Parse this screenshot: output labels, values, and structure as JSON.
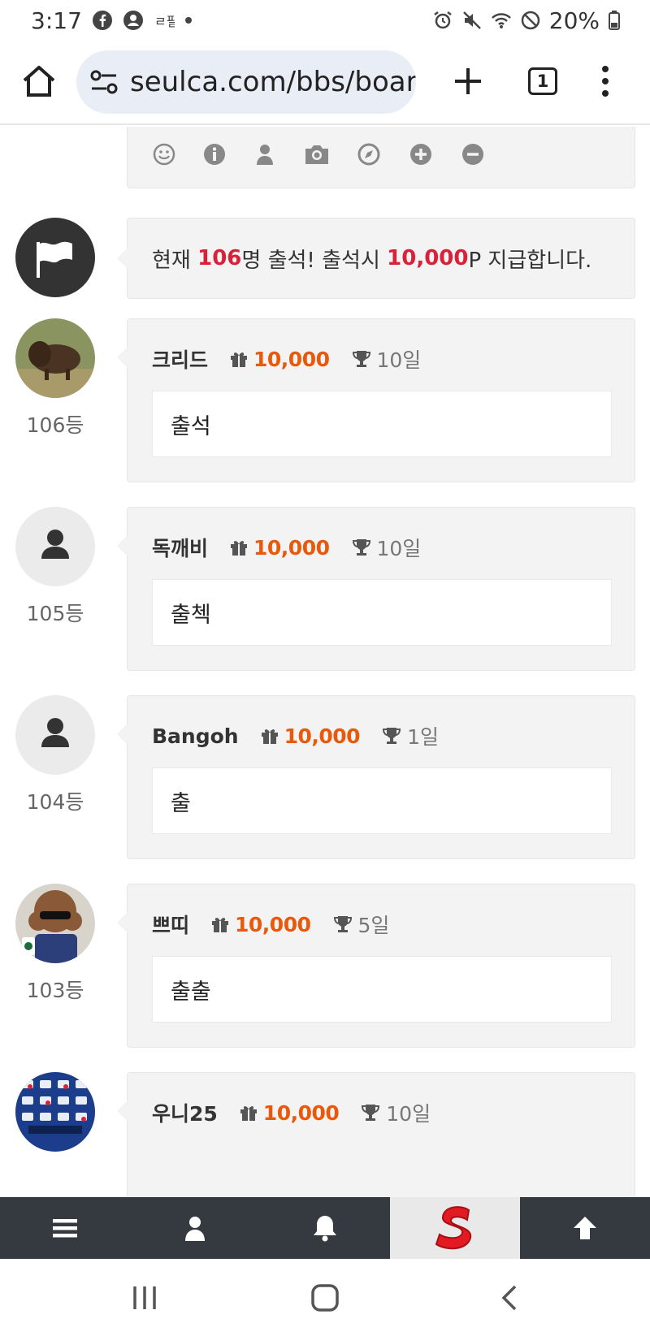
{
  "status_bar": {
    "time": "3:17",
    "battery": "20%",
    "left_icons": [
      "facebook-icon",
      "account-icon",
      "app-notification-icon",
      "dot-icon"
    ],
    "right_icons": [
      "alarm-icon",
      "mute-icon",
      "wifi-icon",
      "do-not-disturb-icon",
      "battery-charging-icon"
    ]
  },
  "browser": {
    "url": "seulca.com/bbs/boarc",
    "tab_count": "1"
  },
  "notice": {
    "prefix": "현재 ",
    "count": "106",
    "middle": "명 출석! 출석시 ",
    "points": "10,000",
    "suffix": "P 지급합니다."
  },
  "entries": [
    {
      "name": "크리드",
      "points": "10,000",
      "days": "10일",
      "message": "출석",
      "rank": "106등",
      "avatar": "bison-photo"
    },
    {
      "name": "독깨비",
      "points": "10,000",
      "days": "10일",
      "message": "출첵",
      "rank": "105등",
      "avatar": "default-user"
    },
    {
      "name": "Bangoh",
      "points": "10,000",
      "days": "1일",
      "message": "출",
      "rank": "104등",
      "avatar": "default-user"
    },
    {
      "name": "쁘띠",
      "points": "10,000",
      "days": "5일",
      "message": "출출",
      "rank": "103등",
      "avatar": "poodle-photo"
    },
    {
      "name": "우니25",
      "points": "10,000",
      "days": "10일",
      "message": "",
      "rank": "",
      "avatar": "slot-photo"
    }
  ],
  "colors": {
    "accent_red": "#d9213a",
    "points_orange": "#e8590c",
    "nav_dark": "#343a40"
  },
  "bottom_nav": [
    "menu-icon",
    "user-icon",
    "bell-icon",
    "site-logo",
    "arrow-up-icon"
  ]
}
